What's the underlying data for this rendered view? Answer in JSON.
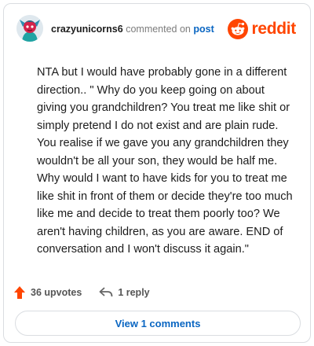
{
  "header": {
    "username": "crazyunicorns6",
    "commented_on": "commented on",
    "post_link": "post",
    "brand_name": "reddit"
  },
  "comment": {
    "text": "NTA but I would have probably gone in a different direction.. \" Why do you keep going on about giving you grandchildren? You treat me like shit or simply pretend I do not exist and are plain rude. You realise if we gave you any grandchildren they wouldn't be all your son, they would be half me. Why would I want to have kids for you to treat me like shit in front of them or decide they're too much like me and decide to treat them poorly too? We aren't having children, as you are aware. END of conversation and I won't discuss it again.\""
  },
  "actions": {
    "upvotes": "36 upvotes",
    "replies": "1 reply"
  },
  "footer": {
    "view_comments": "View 1 comments"
  },
  "colors": {
    "brand": "#ff4500",
    "link": "#0a66c2",
    "upvote": "#ff4500"
  },
  "icons": [
    "avatar-icon",
    "reddit-logo-icon",
    "upvote-arrow-icon",
    "reply-arrow-icon"
  ]
}
